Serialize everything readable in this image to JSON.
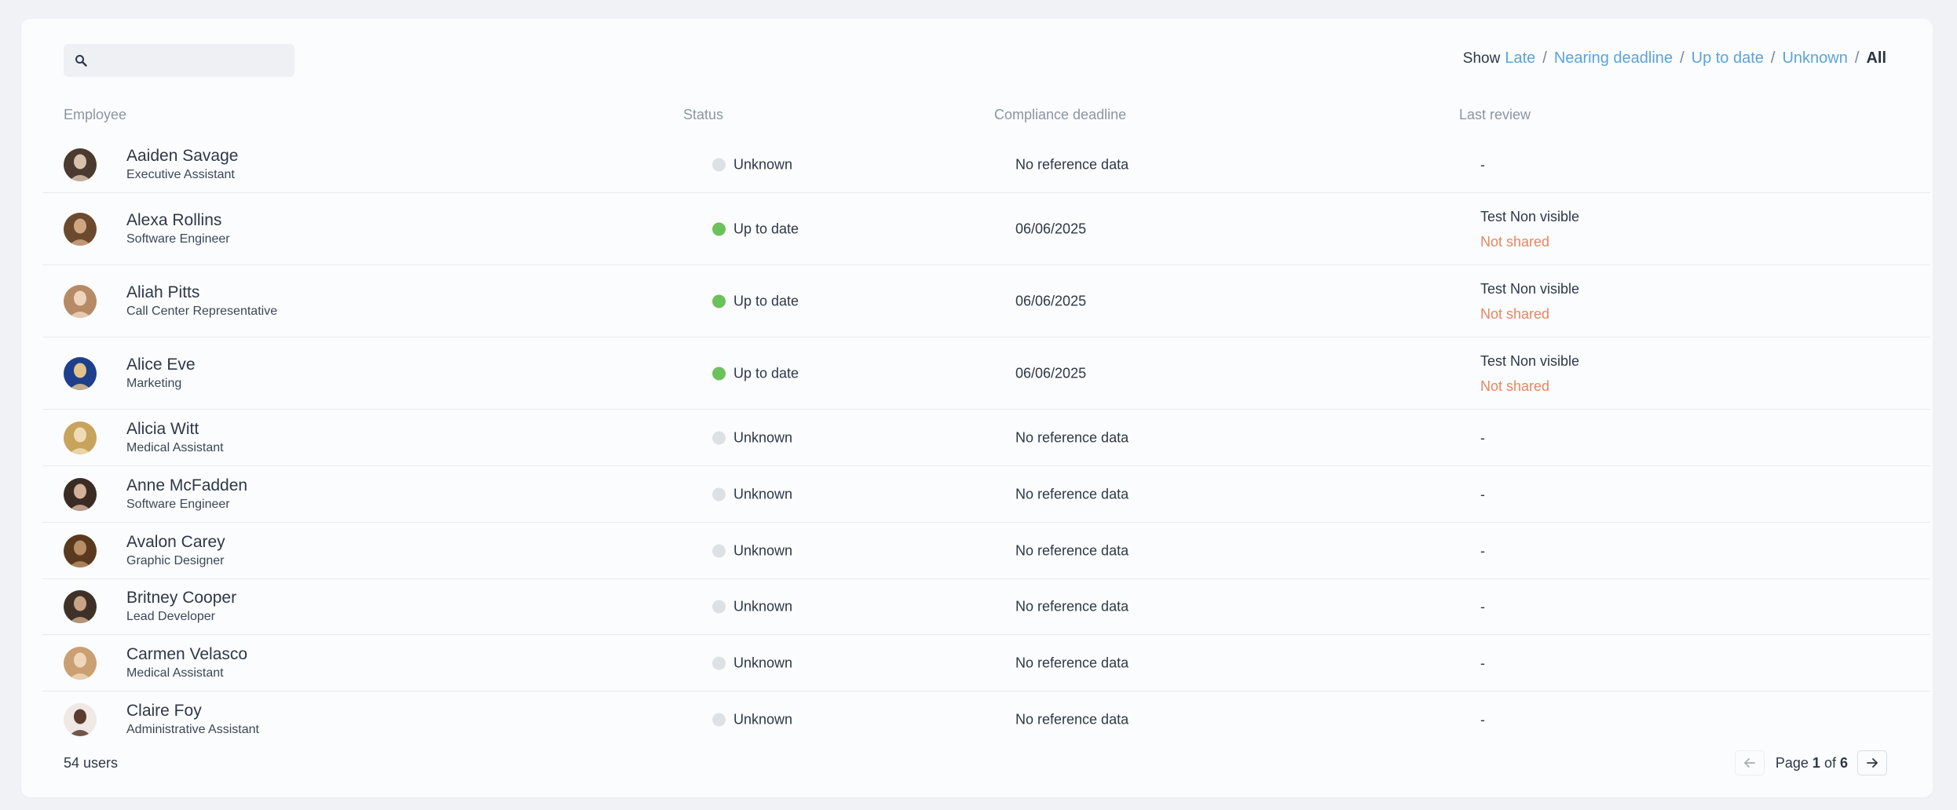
{
  "search": {
    "placeholder": "",
    "value": ""
  },
  "filters": {
    "show_label": "Show",
    "options": [
      "Late",
      "Nearing deadline",
      "Up to date",
      "Unknown",
      "All"
    ],
    "separator": "/",
    "active_index": 4
  },
  "table": {
    "columns": [
      "Employee",
      "Status",
      "Compliance deadline",
      "Last review"
    ],
    "rows": [
      {
        "name": "Aaiden Savage",
        "role": "Executive Assistant",
        "status": "Unknown",
        "deadline": "No reference data",
        "review": "-",
        "review_note": ""
      },
      {
        "name": "Alexa Rollins",
        "role": "Software Engineer",
        "status": "Up to date",
        "deadline": "06/06/2025",
        "review": "Test Non visible",
        "review_note": "Not shared"
      },
      {
        "name": "Aliah Pitts",
        "role": "Call Center Representative",
        "status": "Up to date",
        "deadline": "06/06/2025",
        "review": "Test Non visible",
        "review_note": "Not shared"
      },
      {
        "name": "Alice Eve",
        "role": "Marketing",
        "status": "Up to date",
        "deadline": "06/06/2025",
        "review": "Test Non visible",
        "review_note": "Not shared"
      },
      {
        "name": "Alicia Witt",
        "role": "Medical Assistant",
        "status": "Unknown",
        "deadline": "No reference data",
        "review": "-",
        "review_note": ""
      },
      {
        "name": "Anne McFadden",
        "role": "Software Engineer",
        "status": "Unknown",
        "deadline": "No reference data",
        "review": "-",
        "review_note": ""
      },
      {
        "name": "Avalon Carey",
        "role": "Graphic Designer",
        "status": "Unknown",
        "deadline": "No reference data",
        "review": "-",
        "review_note": ""
      },
      {
        "name": "Britney Cooper",
        "role": "Lead Developer",
        "status": "Unknown",
        "deadline": "No reference data",
        "review": "-",
        "review_note": ""
      },
      {
        "name": "Carmen Velasco",
        "role": "Medical Assistant",
        "status": "Unknown",
        "deadline": "No reference data",
        "review": "-",
        "review_note": ""
      },
      {
        "name": "Claire Foy",
        "role": "Administrative Assistant",
        "status": "Unknown",
        "deadline": "No reference data",
        "review": "-",
        "review_note": ""
      }
    ]
  },
  "footer": {
    "user_count": "54 users",
    "page_label": "Page",
    "current_page": "1",
    "of_label": "of",
    "total_pages": "6"
  },
  "colors": {
    "link": "#5aa3dc",
    "status_up_to_date": "#6cc15a",
    "status_unknown": "#dde1e5",
    "not_shared": "#e8855e"
  }
}
